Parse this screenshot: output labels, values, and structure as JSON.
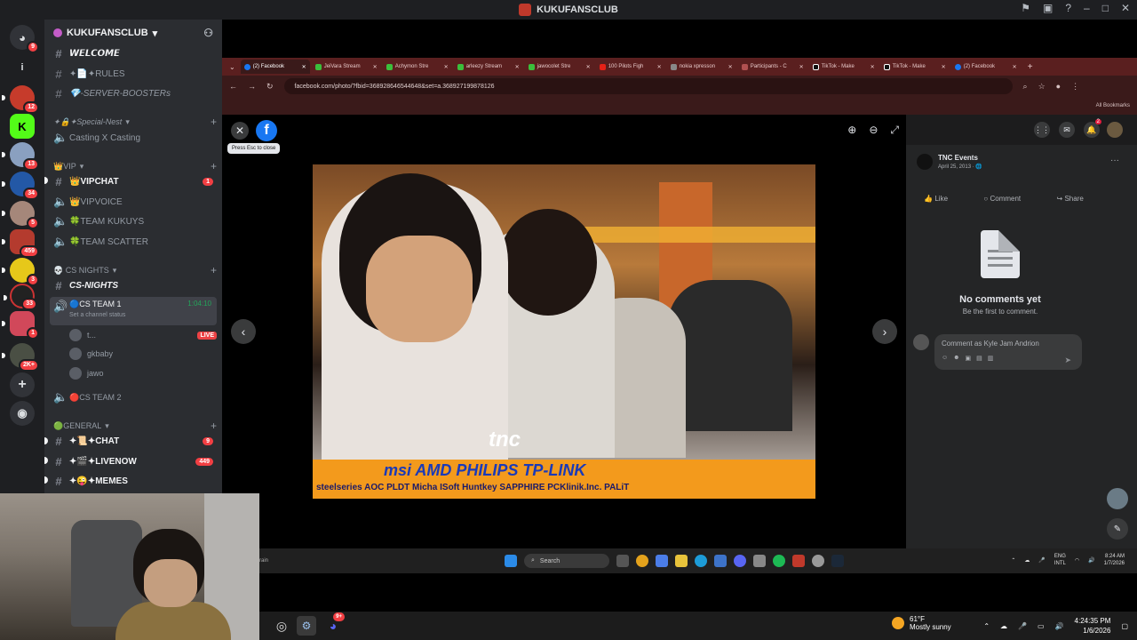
{
  "window": {
    "title": "KUKUFANSCLUB"
  },
  "rail": {
    "badges": [
      "9",
      "12",
      "13",
      "34",
      "5",
      "459",
      "3",
      "33",
      "1",
      "2K+"
    ]
  },
  "guild": {
    "name": "KUKUFANSCLUB"
  },
  "channels": {
    "welcome": "𝙒𝙀𝙇𝘾𝙊𝙈𝙀",
    "rules": "✦📄✦RULES",
    "boosters": "💎-SERVER-BOOSTERs",
    "cat_special": "✦🔒✦Special-Nest",
    "casting": "Casting X Casting",
    "cat_vip": "👑VIP",
    "vipchat": "👑VIPCHAT",
    "vipchat_badge": "1",
    "vipvoice": "👑VIPVOICE",
    "kukuys": "🍀TEAM KUKUYS",
    "scatter": "🍀TEAM SCATTER",
    "cat_cs": "💀 CS NIGHTS",
    "cs_nights": "CS-NIGHTS",
    "cs_team1": "🔵CS TEAM 1",
    "cs_team1_time": "1:04:10",
    "cs_team1_status": "Set a channel status",
    "voice_users": [
      {
        "name": "t...",
        "live": "LIVE"
      },
      {
        "name": "gkbaby"
      },
      {
        "name": "jawo"
      }
    ],
    "cs_team2": "🔴CS TEAM 2",
    "cat_general": "🟢GENERAL",
    "chat": "✦📜✦CHAT",
    "chat_badge": "9",
    "livenow": "✦🎬✦LIVENOW",
    "livenow_badge": "449",
    "memes": "✦😜✦MEMES"
  },
  "browser": {
    "tabs": [
      {
        "label": "(2) Facebook",
        "icon": "facebook-icon"
      },
      {
        "label": "JeiVara Stream",
        "icon": "kick-icon"
      },
      {
        "label": "Achymon Stre",
        "icon": "kick-icon"
      },
      {
        "label": "arleezy Stream",
        "icon": "kick-icon"
      },
      {
        "label": "jawocolet Stre",
        "icon": "kick-icon"
      },
      {
        "label": "100 Pilots Figh",
        "icon": "youtube-icon"
      },
      {
        "label": "nokia xpresson",
        "icon": "google-icon"
      },
      {
        "label": "Participants - C",
        "icon": "page-icon"
      },
      {
        "label": "TikTok - Make",
        "icon": "tiktok-icon"
      },
      {
        "label": "TikTok - Make",
        "icon": "tiktok-icon"
      },
      {
        "label": "(2) Facebook",
        "icon": "facebook-icon"
      }
    ],
    "url": "facebook.com/photo/?fbid=368928646544648&set=a.368927199878126",
    "bookmarks": "All Bookmarks"
  },
  "viewer": {
    "close_tooltip": "Press Esc to close",
    "tnc": "tnc",
    "sponsors_top": "msi  AMD  PHILIPS  TP-LINK",
    "sponsors_bottom": "steelseries  AOC  PLDT  Micha ISoft  Huntkey  SAPPHIRE  PCKlinik.Inc.  PALiT"
  },
  "post": {
    "author": "TNC Events",
    "date": "April 25, 2013 · 🌐",
    "more": "···",
    "like": "Like",
    "comment": "Comment",
    "share": "Share",
    "no_comments": "No comments yet",
    "be_first": "Be the first to comment.",
    "comment_placeholder": "Comment as Kyle Jam Andrion",
    "notif_count": "2"
  },
  "stream_taskbar": {
    "left": "rain",
    "search": "Search",
    "lang1": "ENG",
    "lang2": "INTL",
    "time": "8:24 AM",
    "date": "1/7/2026"
  },
  "taskbar": {
    "weather_temp": "61°F",
    "weather_desc": "Mostly sunny",
    "time": "4:24:35 PM",
    "date": "1/6/2026",
    "discord_badge": "9+"
  }
}
